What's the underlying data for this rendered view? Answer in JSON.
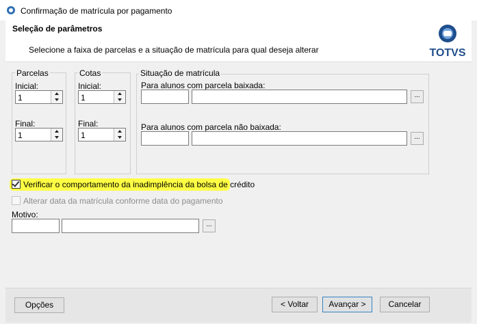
{
  "window": {
    "title": "Confirmação de matrícula por pagamento"
  },
  "header": {
    "title": "Seleção de parâmetros",
    "subtitle": "Selecione a faixa de parcelas e a situação de matrícula para qual deseja alterar",
    "logo_text": "TOTVS"
  },
  "parcelas": {
    "group_label": "Parcelas",
    "inicial_label": "Inicial:",
    "inicial_value": "1",
    "final_label": "Final:",
    "final_value": "1"
  },
  "cotas": {
    "group_label": "Cotas",
    "inicial_label": "Inicial:",
    "inicial_value": "1",
    "final_label": "Final:",
    "final_value": "1"
  },
  "situacao": {
    "group_label": "Situação de matrícula",
    "baixada_label": "Para alunos com parcela baixada:",
    "nao_baixada_label": "Para alunos com parcela não baixada:",
    "lookup_button": "..."
  },
  "options": {
    "verificar_label": "Verificar o comportamento da inadimplência da bolsa de crédito",
    "verificar_checked": true,
    "alterar_label": "Alterar data da matrícula conforme data do pagamento",
    "alterar_checked": false
  },
  "motivo": {
    "label": "Motivo:",
    "lookup_button": "..."
  },
  "footer": {
    "opcoes": "Opções",
    "voltar": "< Voltar",
    "avancar": "Avançar >",
    "cancelar": "Cancelar"
  },
  "colors": {
    "highlight": "#ffff44",
    "brand": "#1f4e8c",
    "accent_button_border": "#3c7fb1"
  }
}
